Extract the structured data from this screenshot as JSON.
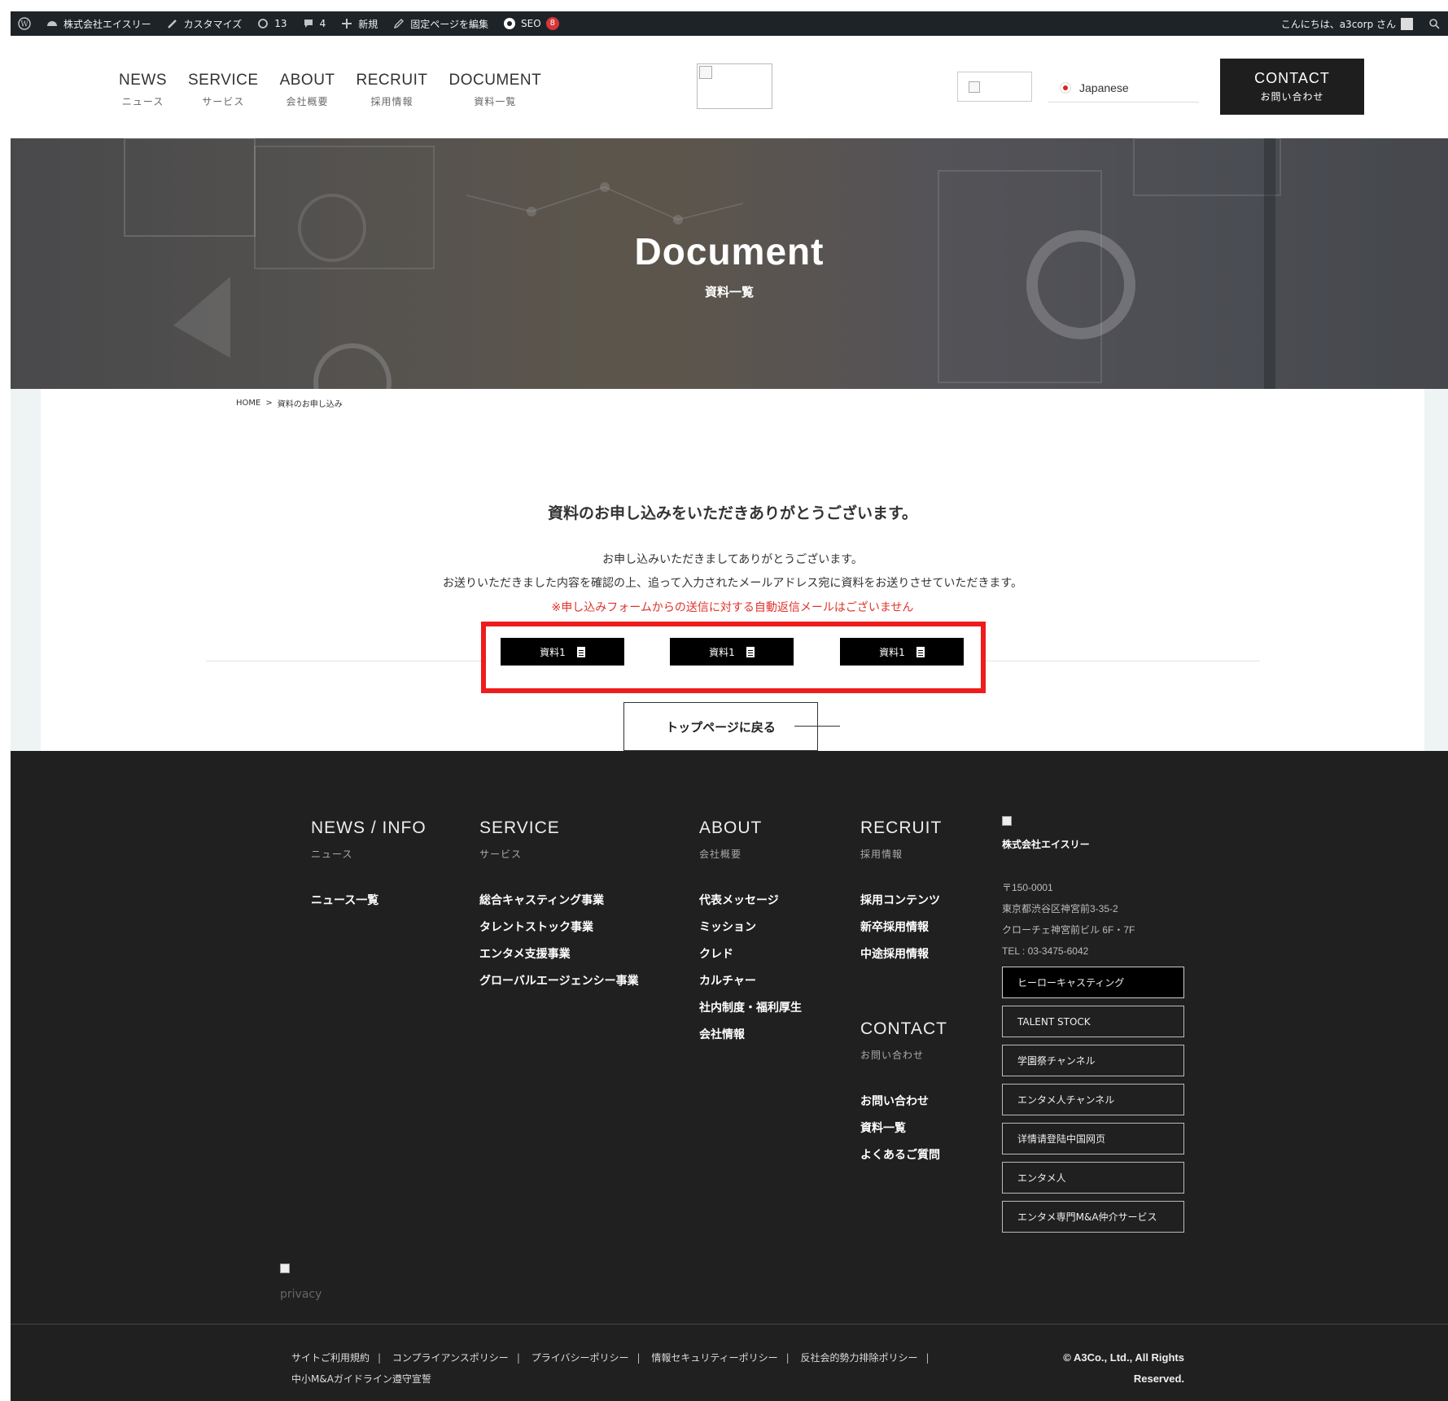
{
  "adminbar": {
    "site_name": "株式会社エイスリー",
    "customize": "カスタマイズ",
    "updates": "13",
    "comments": "4",
    "new": "新規",
    "edit": "固定ページを編集",
    "seo": "SEO",
    "seo_count": "8",
    "greeting": "こんにちは、a3corp さん"
  },
  "nav": [
    {
      "en": "NEWS",
      "ja": "ニュース"
    },
    {
      "en": "SERVICE",
      "ja": "サービス"
    },
    {
      "en": "ABOUT",
      "ja": "会社概要"
    },
    {
      "en": "RECRUIT",
      "ja": "採用情報"
    },
    {
      "en": "DOCUMENT",
      "ja": "資料一覧"
    }
  ],
  "lang": "Japanese",
  "contact": {
    "en": "CONTACT",
    "ja": "お問い合わせ"
  },
  "hero": {
    "title": "Document",
    "subtitle": "資料一覧"
  },
  "breadcrumb": {
    "home": "HOME",
    "sep": ">",
    "current": "資料のお申し込み"
  },
  "main": {
    "title": "資料のお申し込みをいただきありがとうございます。",
    "msg1": "お申し込みいただきましてありがとうございます。",
    "msg2": "お送りいただきました内容を確認の上、追って入力されたメールアドレス宛に資料をお送りさせていただきます。",
    "msg3": "※申し込みフォームからの送信に対する自動返信メールはございません",
    "doc_buttons": [
      "資料1",
      "資料1",
      "資料1"
    ],
    "back": "トップページに戻る"
  },
  "footer": {
    "cols": [
      {
        "en": "NEWS / INFO",
        "ja": "ニュース",
        "items": [
          "ニュース一覧"
        ]
      },
      {
        "en": "SERVICE",
        "ja": "サービス",
        "items": [
          "総合キャスティング事業",
          "タレントストック事業",
          "エンタメ支援事業",
          "グローバルエージェンシー事業"
        ]
      },
      {
        "en": "ABOUT",
        "ja": "会社概要",
        "items": [
          "代表メッセージ",
          "ミッション",
          "クレド",
          "カルチャー",
          "社内制度・福利厚生",
          "会社情報"
        ]
      },
      {
        "en": "RECRUIT",
        "ja": "採用情報",
        "items": [
          "採用コンテンツ",
          "新卒採用情報",
          "中途採用情報"
        ]
      },
      {
        "en": "CONTACT",
        "ja": "お問い合わせ",
        "items": [
          "お問い合わせ",
          "資料一覧",
          "よくあるご質問"
        ]
      }
    ],
    "company": {
      "name": "株式会社エイスリー",
      "zip": "〒150-0001",
      "addr1": "東京都渋谷区神宮前3-35-2",
      "addr2": "クローチェ神宮前ビル 6F・7F",
      "tel": "TEL : 03-3475-6042"
    },
    "buttons": [
      "ヒーローキャスティング",
      "TALENT STOCK",
      "学園祭チャンネル",
      "エンタメ人チャンネル",
      "详情请登陆中国网页",
      "エンタメ人",
      "エンタメ専門M&A仲介サービス"
    ],
    "privacy_alt": "privacy",
    "links": [
      "サイトご利用規約",
      "コンプライアンスポリシー",
      "プライバシーポリシー",
      "情報セキュリティーポリシー",
      "反社会的勢力排除ポリシー",
      "中小M&Aガイドライン遵守宣誓"
    ],
    "copyright1": "© A3Co., Ltd., All Rights",
    "copyright2": "Reserved."
  }
}
